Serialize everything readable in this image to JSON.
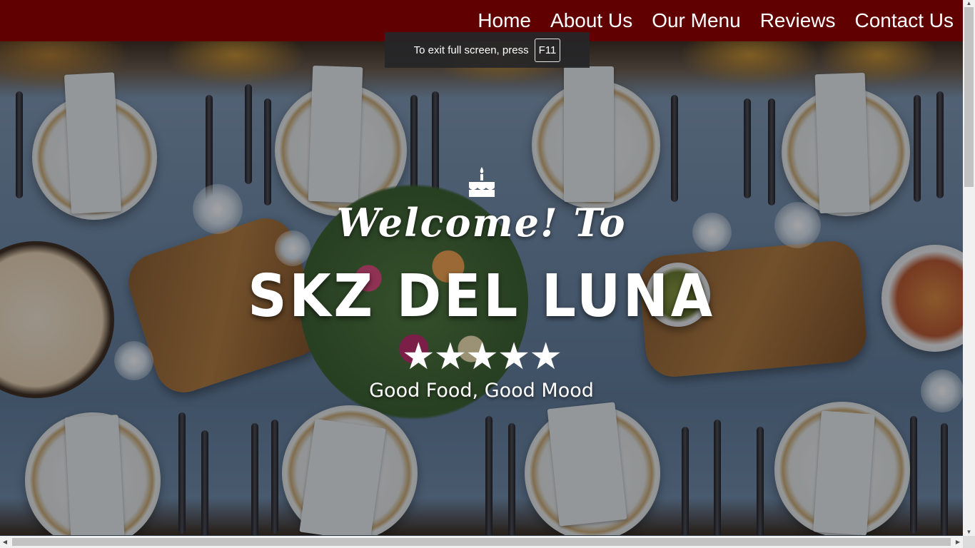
{
  "nav": {
    "items": [
      {
        "label": "Home"
      },
      {
        "label": "About Us"
      },
      {
        "label": "Our Menu"
      },
      {
        "label": "Reviews"
      },
      {
        "label": "Contact Us"
      }
    ],
    "bg_color": "#600000"
  },
  "fullscreen_notice": {
    "text": "To exit full screen, press",
    "key": "F11"
  },
  "hero": {
    "icon": "birthday-cake-icon",
    "welcome": "Welcome! To",
    "brand": "SKZ DEL LUNA",
    "rating": 5,
    "rating_max": 5,
    "stars": "★★★★★",
    "tagline": "Good Food, Good Mood"
  },
  "colors": {
    "nav_bg": "#600000",
    "hero_text": "#ffffff"
  }
}
